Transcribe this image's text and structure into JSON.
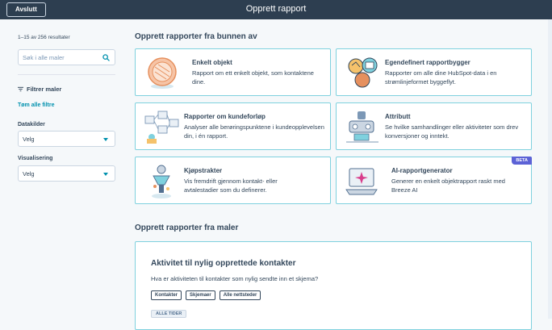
{
  "header": {
    "exit_label": "Avslutt",
    "title": "Opprett rapport"
  },
  "sidebar": {
    "results_text": "1–15 av 256 resultater",
    "search_placeholder": "Søk i alle maler",
    "filter_heading": "Filtrer maler",
    "clear_filters": "Tøm alle filtre",
    "data_sources_label": "Datakilder",
    "data_sources_value": "Velg",
    "visualization_label": "Visualisering",
    "visualization_value": "Velg"
  },
  "scratch_section": {
    "heading": "Opprett rapporter fra bunnen av",
    "cards": [
      {
        "title": "Enkelt objekt",
        "desc": "Rapport om ett enkelt objekt, som kontaktene dine.",
        "icon": "single-object-icon"
      },
      {
        "title": "Egendefinert rapportbygger",
        "desc": "Rapporter om alle dine HubSpot-data i en strømlinjeformet byggeflyt.",
        "icon": "custom-builder-icon"
      },
      {
        "title": "Rapporter om kundeforløp",
        "desc": "Analyser alle berøringspunktene i kundeopplevelsen din, i én rapport.",
        "icon": "customer-journey-icon"
      },
      {
        "title": "Attributt",
        "desc": "Se hvilke samhandlinger eller aktiviteter som drev konversjoner og inntekt.",
        "icon": "attribution-icon"
      },
      {
        "title": "Kjøpstrakter",
        "desc": "Vis fremdrift gjennom kontakt- eller avtalestadier som du definerer.",
        "icon": "funnel-icon"
      },
      {
        "title": "AI-rapportgenerator",
        "desc": "Generer en enkelt objektrapport raskt med Breeze AI",
        "icon": "ai-generator-icon",
        "badge": "BETA"
      }
    ]
  },
  "template_section": {
    "heading": "Opprett rapporter fra maler",
    "card": {
      "title": "Aktivitet til nylig opprettede kontakter",
      "desc": "Hva er aktiviteten til kontakter som nylig sendte inn et skjema?",
      "tags": [
        "Kontakter",
        "Skjemaer",
        "Alle nettsteder"
      ],
      "period": "ALLE TIDER"
    }
  },
  "colors": {
    "topbar": "#2d3e50",
    "accent": "#0091ae",
    "card_border": "#7fd1de",
    "beta": "#5c62d6"
  }
}
